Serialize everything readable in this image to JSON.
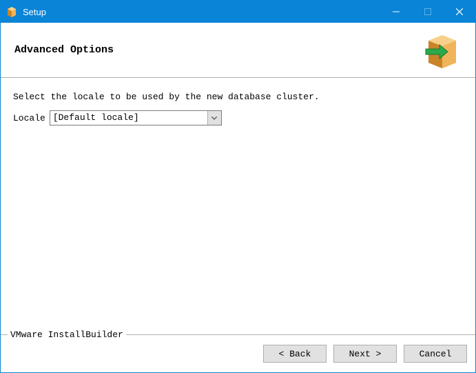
{
  "window": {
    "title": "Setup"
  },
  "header": {
    "page_title": "Advanced Options"
  },
  "content": {
    "instruction": "Select the locale to be used by the new database cluster.",
    "locale_label": "Locale",
    "locale_value": "[Default locale]"
  },
  "footer": {
    "branding": "VMware InstallBuilder",
    "back_label": "< Back",
    "next_label": "Next >",
    "cancel_label": "Cancel"
  }
}
